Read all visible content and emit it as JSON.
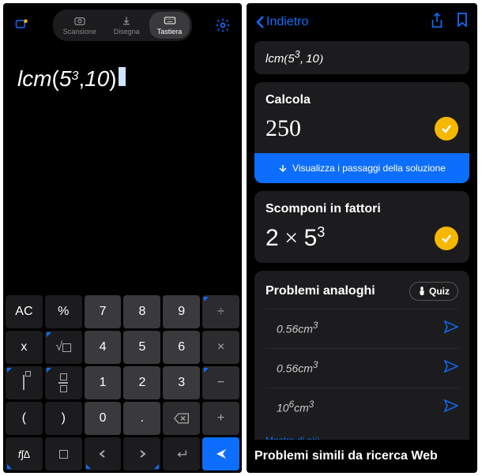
{
  "left": {
    "modes": [
      {
        "label": "Scansione",
        "icon": "camera"
      },
      {
        "label": "Disegna",
        "icon": "draw"
      },
      {
        "label": "Tastiera",
        "icon": "keyboard",
        "active": true
      }
    ],
    "expression": {
      "func": "lcm",
      "arg1_base": "5",
      "arg1_exp": "3",
      "arg2": "10"
    },
    "keypad": {
      "row1": [
        "AC",
        "%",
        "7",
        "8",
        "9",
        "÷"
      ],
      "row2": [
        "x",
        "√□",
        "4",
        "5",
        "6",
        "×"
      ],
      "row3": [
        "^",
        "□/□",
        "1",
        "2",
        "3",
        "−"
      ],
      "row4": [
        "(",
        ")",
        "0",
        ".",
        "⌫",
        "+"
      ],
      "row5": [
        "f∫∆",
        "",
        "←",
        "→",
        "↵",
        "▶"
      ]
    }
  },
  "right": {
    "back_label": "Indietro",
    "expression_display": {
      "func": "lcm",
      "arg1_base": "5",
      "arg1_exp": "3",
      "arg2": "10"
    },
    "calcola": {
      "title": "Calcola",
      "result": "250",
      "steps_label": "Visualizza i passaggi della soluzione"
    },
    "scomponi": {
      "title": "Scomponi in fattori",
      "result_base1": "2",
      "result_base2": "5",
      "result_exp2": "3"
    },
    "similar": {
      "title": "Problemi analoghi",
      "quiz_label": "Quiz",
      "problems": [
        {
          "coef": "0.56",
          "var": "cm",
          "exp": "3"
        },
        {
          "coef": "0.56",
          "var": "cm",
          "exp": "3"
        },
        {
          "coef_base": "10",
          "coef_exp": "6",
          "var": "cm",
          "exp": "3"
        }
      ],
      "show_more": "Mostra di più"
    },
    "web_title": "Problemi simili da ricerca Web"
  }
}
